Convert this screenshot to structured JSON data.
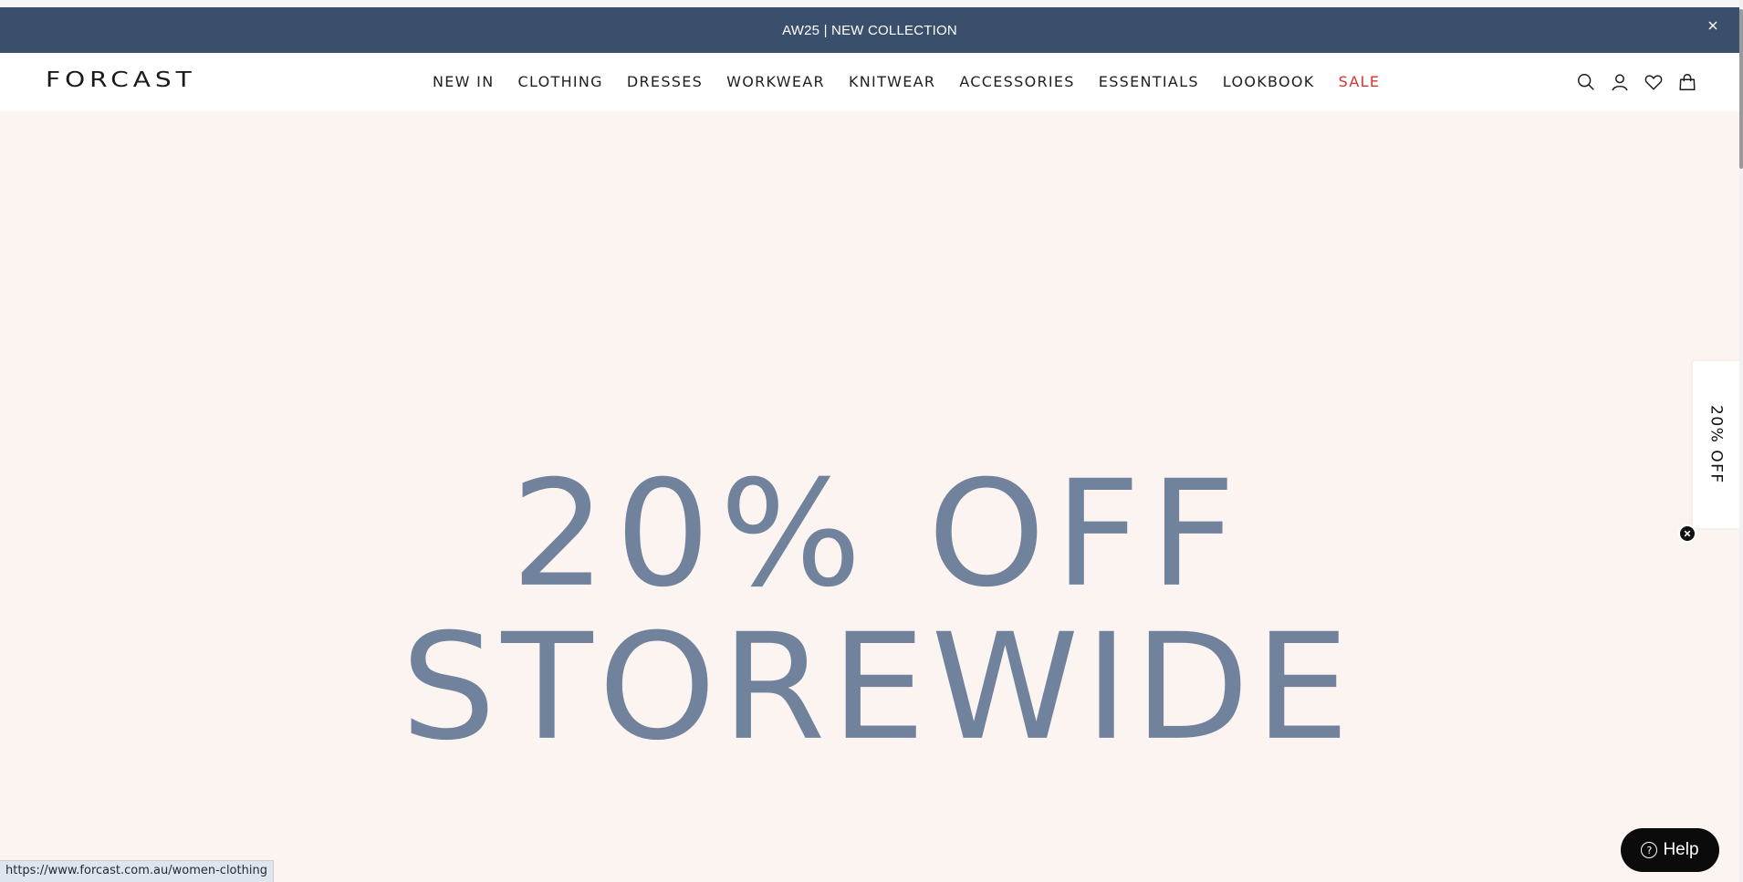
{
  "announcement": {
    "text": "AW25 | NEW COLLECTION",
    "close_icon": "close-icon",
    "background": "#3a4f6c"
  },
  "header": {
    "logo": "FORCAST",
    "nav": [
      {
        "label": "NEW IN"
      },
      {
        "label": "CLOTHING"
      },
      {
        "label": "DRESSES"
      },
      {
        "label": "WORKWEAR"
      },
      {
        "label": "KNITWEAR"
      },
      {
        "label": "ACCESSORIES"
      },
      {
        "label": "ESSENTIALS"
      },
      {
        "label": "LOOKBOOK"
      },
      {
        "label": "SALE"
      }
    ],
    "sale_color": "#d6322f",
    "icons": [
      "search-icon",
      "account-icon",
      "wishlist-icon",
      "cart-icon"
    ]
  },
  "hero": {
    "line1": "20% OFF",
    "line2": "STOREWIDE",
    "background": "#fcf4f0",
    "text_color": "#71829d"
  },
  "discount_tab": {
    "label": "20% OFF",
    "close_icon": "close-icon"
  },
  "help": {
    "label": "Help",
    "icon": "question-circle-icon"
  },
  "status_bar": {
    "url": "https://www.forcast.com.au/women-clothing"
  }
}
